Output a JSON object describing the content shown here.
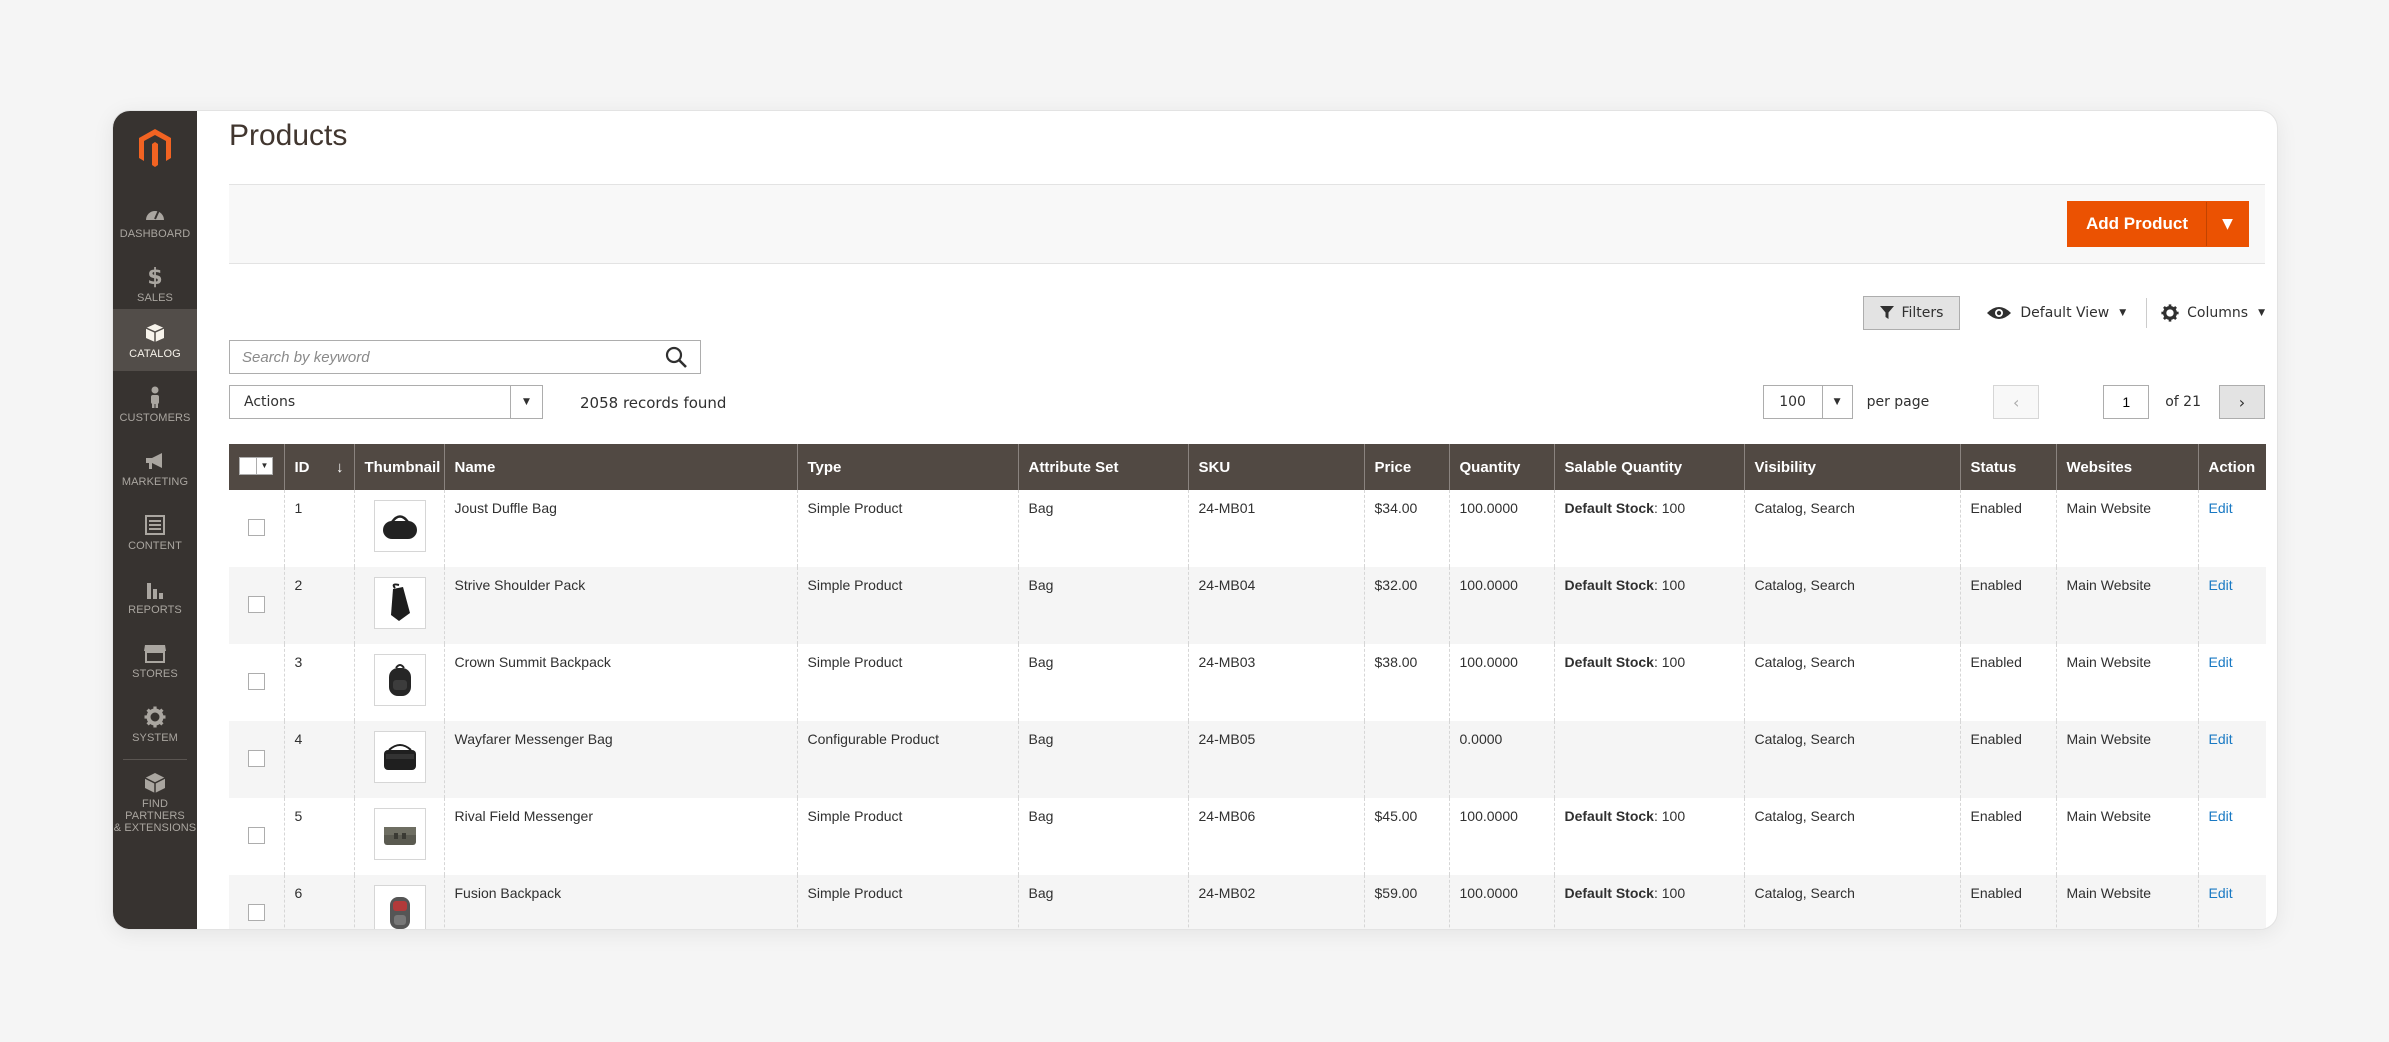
{
  "sidebar": {
    "items": [
      {
        "label": "DASHBOARD",
        "icon": "dashboard-icon"
      },
      {
        "label": "SALES",
        "icon": "dollar-icon"
      },
      {
        "label": "CATALOG",
        "icon": "box-icon",
        "active": true
      },
      {
        "label": "CUSTOMERS",
        "icon": "person-icon"
      },
      {
        "label": "MARKETING",
        "icon": "megaphone-icon"
      },
      {
        "label": "CONTENT",
        "icon": "content-icon"
      },
      {
        "label": "REPORTS",
        "icon": "bar-chart-icon"
      },
      {
        "label": "STORES",
        "icon": "store-icon"
      },
      {
        "label": "SYSTEM",
        "icon": "gear-icon"
      }
    ],
    "partners_line1": "FIND PARTNERS",
    "partners_line2": "& EXTENSIONS"
  },
  "page": {
    "title": "Products"
  },
  "add_product": {
    "label": "Add Product",
    "split_caret": "▼"
  },
  "toolbar": {
    "filters_label": "Filters",
    "view_label": "Default View",
    "columns_label": "Columns"
  },
  "search": {
    "placeholder": "Search by keyword"
  },
  "mass_actions": {
    "label": "Actions"
  },
  "records_found": "2058 records found",
  "pager": {
    "per_page_value": "100",
    "per_page_label": "per page",
    "current_page": "1",
    "of_pages": "of 21"
  },
  "grid": {
    "headers": [
      "ID",
      "Thumbnail",
      "Name",
      "Type",
      "Attribute Set",
      "SKU",
      "Price",
      "Quantity",
      "Salable Quantity",
      "Visibility",
      "Status",
      "Websites",
      "Action"
    ],
    "sort_indicator": "↓",
    "stock_label": "Default Stock",
    "rows": [
      {
        "id": "1",
        "name": "Joust Duffle Bag",
        "type": "Simple Product",
        "attr_set": "Bag",
        "sku": "24-MB01",
        "price": "$34.00",
        "qty": "100.0000",
        "salable": ": 100",
        "visibility": "Catalog, Search",
        "status": "Enabled",
        "website": "Main Website",
        "action": "Edit",
        "thumb": "duffle-bag-icon"
      },
      {
        "id": "2",
        "name": "Strive Shoulder Pack",
        "type": "Simple Product",
        "attr_set": "Bag",
        "sku": "24-MB04",
        "price": "$32.00",
        "qty": "100.0000",
        "salable": ": 100",
        "visibility": "Catalog, Search",
        "status": "Enabled",
        "website": "Main Website",
        "action": "Edit",
        "thumb": "shoulder-pack-icon"
      },
      {
        "id": "3",
        "name": "Crown Summit Backpack",
        "type": "Simple Product",
        "attr_set": "Bag",
        "sku": "24-MB03",
        "price": "$38.00",
        "qty": "100.0000",
        "salable": ": 100",
        "visibility": "Catalog, Search",
        "status": "Enabled",
        "website": "Main Website",
        "action": "Edit",
        "thumb": "backpack-icon"
      },
      {
        "id": "4",
        "name": "Wayfarer Messenger Bag",
        "type": "Configurable Product",
        "attr_set": "Bag",
        "sku": "24-MB05",
        "price": "",
        "qty": "0.0000",
        "salable": "",
        "visibility": "Catalog, Search",
        "status": "Enabled",
        "website": "Main Website",
        "action": "Edit",
        "thumb": "messenger-bag-icon"
      },
      {
        "id": "5",
        "name": "Rival Field Messenger",
        "type": "Simple Product",
        "attr_set": "Bag",
        "sku": "24-MB06",
        "price": "$45.00",
        "qty": "100.0000",
        "salable": ": 100",
        "visibility": "Catalog, Search",
        "status": "Enabled",
        "website": "Main Website",
        "action": "Edit",
        "thumb": "field-messenger-icon"
      },
      {
        "id": "6",
        "name": "Fusion Backpack",
        "type": "Simple Product",
        "attr_set": "Bag",
        "sku": "24-MB02",
        "price": "$59.00",
        "qty": "100.0000",
        "salable": ": 100",
        "visibility": "Catalog, Search",
        "status": "Enabled",
        "website": "Main Website",
        "action": "Edit",
        "thumb": "fusion-backpack-icon"
      }
    ]
  },
  "colors": {
    "accent": "#eb5202",
    "sidebar": "#373330",
    "header": "#514943",
    "link": "#1979c3"
  }
}
